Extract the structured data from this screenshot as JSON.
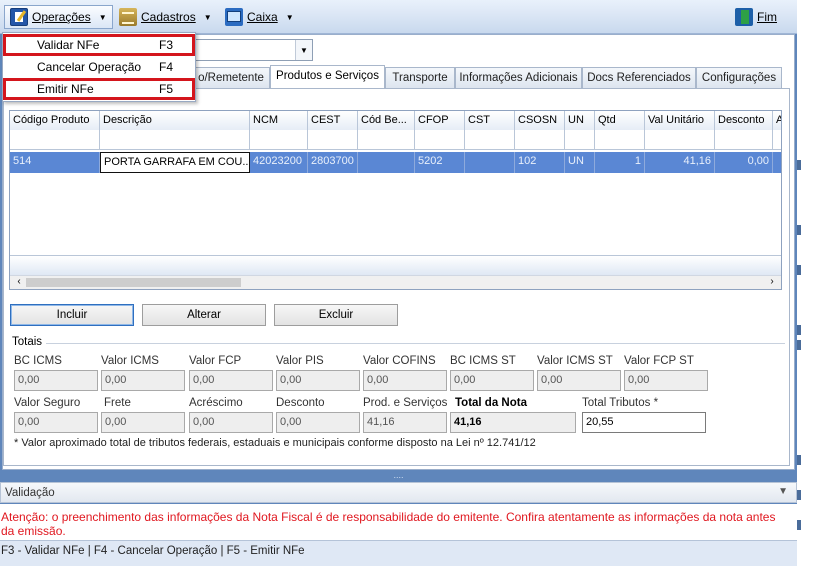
{
  "toolbar": {
    "operacoes": "Operações",
    "cadastros": "Cadastros",
    "caixa": "Caixa",
    "fim": "Fim"
  },
  "menu": {
    "items": [
      {
        "label": "Validar NFe",
        "key": "F3",
        "highlighted": true
      },
      {
        "label": "Cancelar Operação",
        "key": "F4",
        "highlighted": false
      },
      {
        "label": "Emitir NFe",
        "key": "F5",
        "highlighted": true
      }
    ]
  },
  "tabs": [
    {
      "label": "o/Remetente"
    },
    {
      "label": "Produtos e Serviços",
      "selected": true
    },
    {
      "label": "Transporte"
    },
    {
      "label": "Informações Adicionais"
    },
    {
      "label": "Docs Referenciados"
    },
    {
      "label": "Configurações"
    }
  ],
  "grid": {
    "headers": [
      "Código Produto",
      "Descrição",
      "NCM",
      "CEST",
      "Cód Be...",
      "CFOP",
      "CST",
      "CSOSN",
      "UN",
      "Qtd",
      "Val Unitário",
      "Desconto",
      "A"
    ],
    "rows": [
      [
        "514",
        "PORTA GARRAFA EM COU...",
        "42023200",
        "2803700",
        "",
        "5202",
        "",
        "102",
        "UN",
        "1",
        "41,16",
        "0,00",
        ""
      ]
    ]
  },
  "buttons": {
    "incluir": "Incluir",
    "alterar": "Alterar",
    "excluir": "Excluir"
  },
  "totais": {
    "title": "Totais",
    "row1": [
      {
        "label": "BC ICMS",
        "value": "0,00"
      },
      {
        "label": "Valor ICMS",
        "value": "0,00"
      },
      {
        "label": "Valor FCP",
        "value": "0,00"
      },
      {
        "label": "Valor PIS",
        "value": "0,00"
      },
      {
        "label": "Valor COFINS",
        "value": "0,00"
      },
      {
        "label": "BC ICMS ST",
        "value": "0,00"
      },
      {
        "label": "Valor ICMS ST",
        "value": "0,00"
      },
      {
        "label": "Valor FCP ST",
        "value": "0,00"
      }
    ],
    "row2": [
      {
        "label": "Valor Seguro",
        "value": "0,00"
      },
      {
        "label": "Frete",
        "value": "0,00"
      },
      {
        "label": "Acréscimo",
        "value": "0,00"
      },
      {
        "label": "Desconto",
        "value": "0,00"
      },
      {
        "label": "Prod. e Serviços",
        "value": "41,16"
      },
      {
        "label": "Total da Nota",
        "value": "41,16"
      },
      {
        "label": "Total Tributos *",
        "value": "20,55"
      }
    ],
    "note": "* Valor aproximado total de tributos federais, estaduais e municipais conforme disposto na Lei nº 12.741/12"
  },
  "validacao": {
    "title": "Validação",
    "message": "Atenção: o preenchimento das informações da Nota Fiscal é de responsabilidade do emitente. Confira atentamente as informações da nota antes da emissão."
  },
  "statusbar": {
    "text": "F3 - Validar NFe   | F4 - Cancelar Operação |  F5 - Emitir NFe"
  },
  "colors": {
    "window_bg": "#5f86bb",
    "selected_row": "#5a87d4",
    "highlight_border": "#d4151c",
    "warning_text": "#e0171f"
  }
}
